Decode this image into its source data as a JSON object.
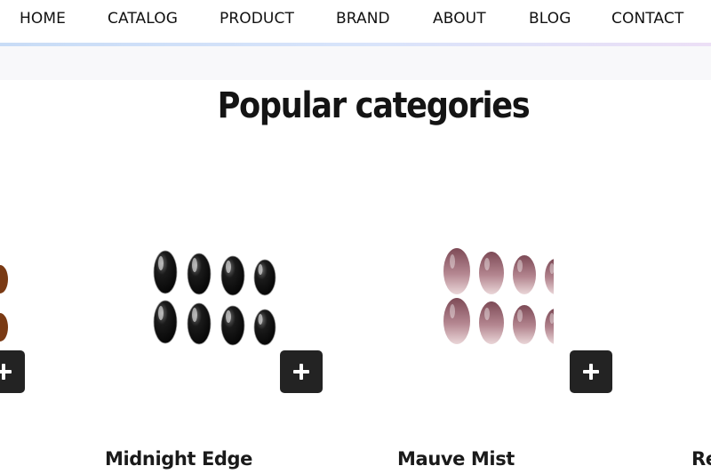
{
  "nav": {
    "items": [
      {
        "label": "HOME"
      },
      {
        "label": "CATALOG"
      },
      {
        "label": "PRODUCT"
      },
      {
        "label": "BRAND"
      },
      {
        "label": "ABOUT"
      },
      {
        "label": "BLOG"
      },
      {
        "label": "CONTACT"
      }
    ]
  },
  "section": {
    "title": "Popular categories"
  },
  "products": [
    {
      "name": "",
      "nail_color": "#7a3a14",
      "icon": "brown-nails-image"
    },
    {
      "name": "Midnight Edge",
      "nail_color": "#0d0d0d",
      "icon": "black-nails-image"
    },
    {
      "name": "Mauve Mist",
      "nail_color": "#8b5a66",
      "icon": "mauve-nails-image"
    },
    {
      "name": "Re",
      "nail_color": "#b04040",
      "icon": "red-nails-image"
    }
  ],
  "add_button": {
    "icon": "plus-icon"
  },
  "colors": {
    "accent_dark": "#232323",
    "nav_underline": "#c8dcf6"
  }
}
